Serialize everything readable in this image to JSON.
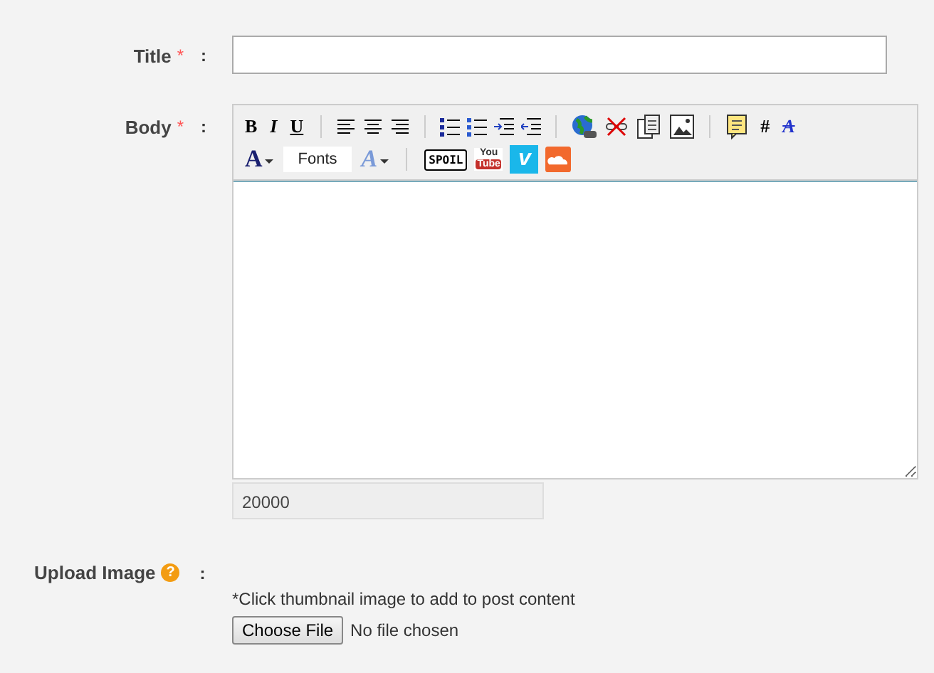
{
  "fields": [
    {
      "label": "Title",
      "required": "*",
      "colon": ":"
    },
    {
      "label": "Body",
      "required": "*",
      "colon": ":"
    }
  ],
  "toolbar": [
    [
      {
        "kind": "bold",
        "text": "B"
      },
      {
        "kind": "italic",
        "text": "I"
      },
      {
        "kind": "underline",
        "text": "U"
      },
      {
        "kind": "sep"
      },
      {
        "kind": "align-left"
      },
      {
        "kind": "align-center"
      },
      {
        "kind": "align-right"
      },
      {
        "kind": "sep"
      },
      {
        "kind": "bullet-list"
      },
      {
        "kind": "number-list"
      },
      {
        "kind": "indent"
      },
      {
        "kind": "outdent"
      },
      {
        "kind": "sep"
      },
      {
        "kind": "globe"
      },
      {
        "kind": "unlink"
      },
      {
        "kind": "document"
      },
      {
        "kind": "image"
      },
      {
        "kind": "sep"
      },
      {
        "kind": "note"
      },
      {
        "kind": "hash",
        "text": "#"
      },
      {
        "kind": "strike-a",
        "text": "A"
      }
    ],
    [
      {
        "kind": "color-a",
        "text": "A"
      },
      {
        "kind": "fonts",
        "text": "Fonts"
      },
      {
        "kind": "size-a",
        "text": "A"
      },
      {
        "kind": "sep"
      },
      {
        "kind": "spoil",
        "text": "SPOIL"
      },
      {
        "kind": "youtube",
        "text": "You",
        "text2": "Tube"
      },
      {
        "kind": "vimeo",
        "text": "v"
      },
      {
        "kind": "cloud"
      }
    ]
  ],
  "counter": "20000",
  "upload": {
    "label": "Upload Image",
    "help": "?",
    "colon": ":",
    "hint": "*Click thumbnail image to add to post content",
    "button": "Choose File",
    "status": "No file chosen"
  }
}
